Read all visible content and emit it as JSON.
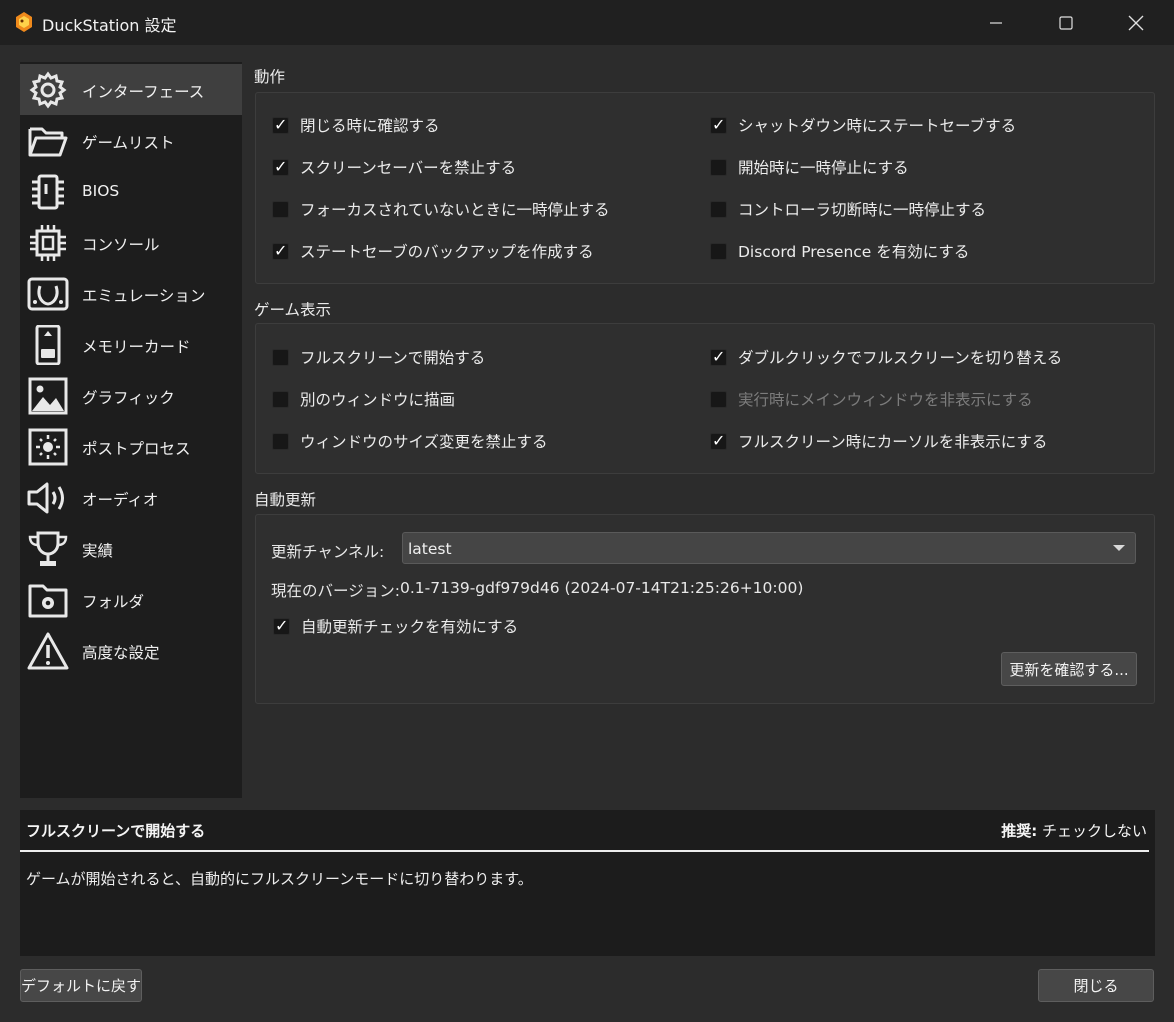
{
  "window": {
    "title": "DuckStation 設定"
  },
  "colors": {
    "window_bg": "#2c2c2c",
    "titlebar_bg": "#202020",
    "sidebar_bg": "#1d1d1d",
    "sidebar_active": "#3f3f3f",
    "app_icon_orange": "#f08a1c"
  },
  "sidebar": {
    "items": [
      {
        "label": "インターフェース",
        "icon": "gear-icon"
      },
      {
        "label": "ゲームリスト",
        "icon": "folder-open-icon"
      },
      {
        "label": "BIOS",
        "icon": "chip-icon"
      },
      {
        "label": "コンソール",
        "icon": "cpu-icon"
      },
      {
        "label": "エミュレーション",
        "icon": "emulation-icon"
      },
      {
        "label": "メモリーカード",
        "icon": "memory-card-icon"
      },
      {
        "label": "グラフィック",
        "icon": "image-icon"
      },
      {
        "label": "ポストプロセス",
        "icon": "brightness-icon"
      },
      {
        "label": "オーディオ",
        "icon": "speaker-icon"
      },
      {
        "label": "実績",
        "icon": "trophy-icon"
      },
      {
        "label": "フォルダ",
        "icon": "folder-settings-icon"
      },
      {
        "label": "高度な設定",
        "icon": "warning-icon"
      }
    ],
    "active_index": 0
  },
  "behavior": {
    "title": "動作",
    "left": [
      {
        "label": "閉じる時に確認する",
        "checked": true
      },
      {
        "label": "スクリーンセーバーを禁止する",
        "checked": true
      },
      {
        "label": "フォーカスされていないときに一時停止する",
        "checked": false
      },
      {
        "label": "ステートセーブのバックアップを作成する",
        "checked": true
      }
    ],
    "right": [
      {
        "label": "シャットダウン時にステートセーブする",
        "checked": true
      },
      {
        "label": "開始時に一時停止にする",
        "checked": false
      },
      {
        "label": "コントローラ切断時に一時停止する",
        "checked": false
      },
      {
        "label": "Discord Presence を有効にする",
        "checked": false
      }
    ]
  },
  "game_display": {
    "title": "ゲーム表示",
    "left": [
      {
        "label": "フルスクリーンで開始する",
        "checked": false
      },
      {
        "label": "別のウィンドウに描画",
        "checked": false
      },
      {
        "label": "ウィンドウのサイズ変更を禁止する",
        "checked": false
      }
    ],
    "right": [
      {
        "label": "ダブルクリックでフルスクリーンを切り替える",
        "checked": true
      },
      {
        "label": "実行時にメインウィンドウを非表示にする",
        "checked": false,
        "disabled": true
      },
      {
        "label": "フルスクリーン時にカーソルを非表示にする",
        "checked": true
      }
    ]
  },
  "auto_update": {
    "title": "自動更新",
    "channel_label": "更新チャンネル:",
    "channel_value": "latest",
    "version_label": "現在のバージョン:",
    "version_value": "0.1-7139-gdf979d46 (2024-07-14T21:25:26+10:00)",
    "enable_check": {
      "label": "自動更新チェックを有効にする",
      "checked": true
    },
    "check_button": "更新を確認する..."
  },
  "description": {
    "title": "フルスクリーンで開始する",
    "recommended_label": "推奨:",
    "recommended_value": " チェックしない",
    "text": "ゲームが開始されると、自動的にフルスクリーンモードに切り替わります。"
  },
  "footer": {
    "restore_defaults": "デフォルトに戻す",
    "close": "閉じる"
  }
}
